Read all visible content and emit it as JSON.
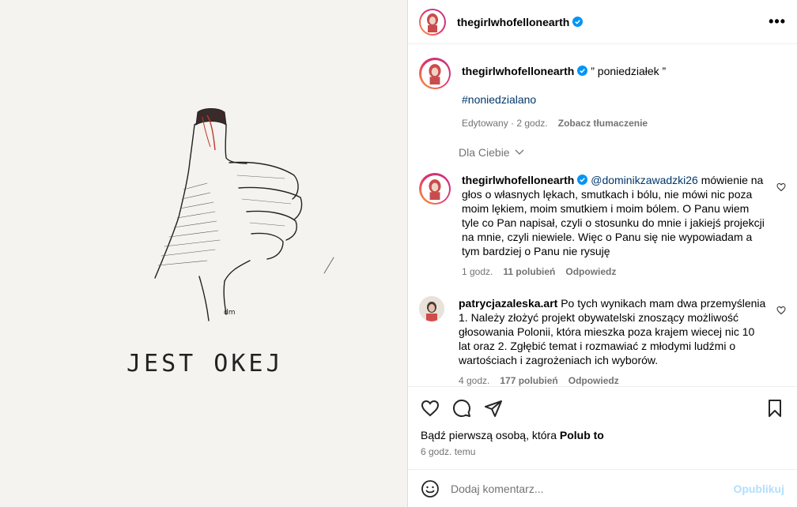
{
  "image": {
    "caption_text": "JEST OKEJ",
    "signature": "dm"
  },
  "header": {
    "username": "thegirlwhofellonearth",
    "more_label": "•••"
  },
  "caption": {
    "username": "thegirlwhofellonearth",
    "text": "” poniedziałek ”",
    "hashtag": "#noniedzialano",
    "edited": "Edytowany · 2 godz.",
    "translate": "Zobacz tłumaczenie"
  },
  "filter": {
    "label": "Dla Ciebie"
  },
  "comments": [
    {
      "username": "thegirlwhofellonearth",
      "mention": "@dominikzawadzki26",
      "text": " mówienie na głos o własnych lękach, smutkach i bólu, nie mówi nic poza moim lękiem, moim smutkiem i moim bólem. O Panu wiem tyle co Pan napisał, czyli o stosunku do mnie i jakiejś projekcji na mnie, czyli niewiele. Więc o Panu się nie wypowiadam a tym bardziej o Panu nie rysuję",
      "time": "1 godz.",
      "likes": "11 polubień",
      "reply": "Odpowiedz"
    },
    {
      "username": "patrycjazaleska.art",
      "text": " Po tych wynikach mam dwa przemyślenia 1. Należy złożyć projekt obywatelski znoszący możliwość głosowania Polonii, która mieszka poza krajem wiecej nic 10 lat oraz 2. Zgłębić temat i rozmawiać z młodymi ludźmi o wartościach i zagrożeniach ich wyborów.",
      "time": "4 godz.",
      "likes": "177 polubień",
      "reply": "Odpowiedz"
    }
  ],
  "footer": {
    "likes_prefix": "Bądź pierwszą osobą, która ",
    "likes_action": "Polub to",
    "time": "6 godz. temu",
    "comment_placeholder": "Dodaj komentarz...",
    "post_label": "Opublikuj"
  },
  "colors": {
    "accent": "#0095f6",
    "verified": "#0095f6",
    "link": "#00376b",
    "muted": "#737373"
  }
}
